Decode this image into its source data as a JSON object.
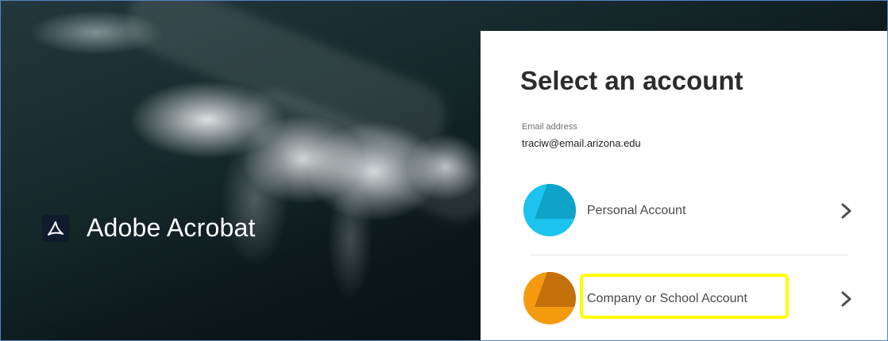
{
  "brand": {
    "name": "Adobe Acrobat",
    "logo_icon": "acrobat-icon"
  },
  "account_picker": {
    "title": "Select an account",
    "email_label": "Email address",
    "email_value": "traciw@email.arizona.edu",
    "accounts": [
      {
        "label": "Personal Account",
        "avatar_color": "#1cc3ee",
        "avatar_shade": "#0fa3c9",
        "chevron_icon": "chevron-right-icon"
      },
      {
        "label": "Company or School Account",
        "avatar_color": "#f59a0e",
        "avatar_shade": "#c4700a",
        "chevron_icon": "chevron-right-icon"
      }
    ]
  },
  "annotation": {
    "highlight_color": "#ffff00",
    "highlighted_item": "Company or School Account"
  }
}
